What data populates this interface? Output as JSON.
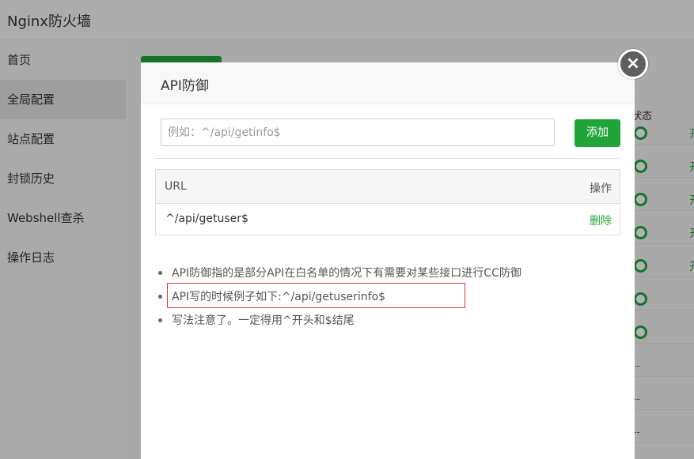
{
  "app": {
    "title": "Nginx防火墙"
  },
  "sidebar": {
    "items": [
      {
        "label": "首页",
        "active": false
      },
      {
        "label": "全局配置",
        "active": true
      },
      {
        "label": "站点配置",
        "active": false
      },
      {
        "label": "封锁历史",
        "active": false
      },
      {
        "label": "Webshell查杀",
        "active": false
      },
      {
        "label": "操作日志",
        "active": false
      }
    ]
  },
  "background_table": {
    "status_header": "状态",
    "cut_char": "开",
    "dash": "--"
  },
  "modal": {
    "title": "API防御",
    "close_icon": "close-icon",
    "input": {
      "placeholder": "例如：^/api/getinfo$",
      "value": ""
    },
    "add_button": "添加",
    "table": {
      "headers": {
        "url": "URL",
        "action": "操作"
      },
      "rows": [
        {
          "url": "^/api/getuser$",
          "action": "删除"
        }
      ]
    },
    "notes": [
      "API防御指的是部分API在白名单的情况下有需要对某些接口进行CC防御",
      "API写的时候例子如下:^/api/getuserinfo$",
      "写法注意了。一定得用^开头和$结尾"
    ]
  },
  "colors": {
    "accent": "#20a53a",
    "highlight": "#d9363e",
    "close_bg": "#5f5f5f"
  }
}
